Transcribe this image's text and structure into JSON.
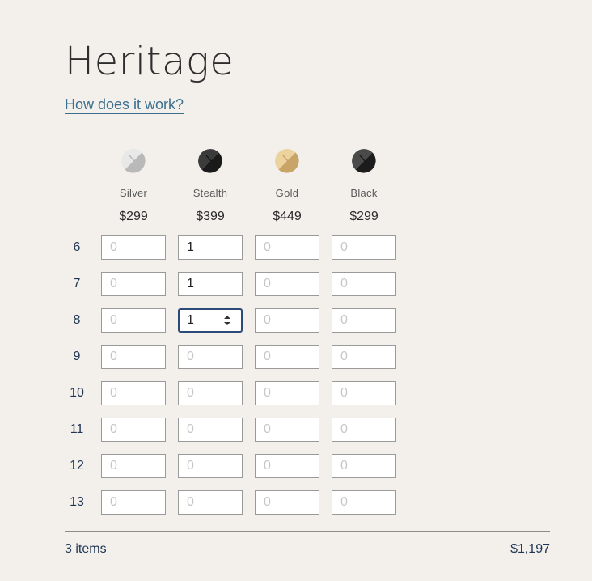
{
  "product": {
    "title": "Heritage",
    "help_link": "How does it work?"
  },
  "variants": [
    {
      "name": "Silver",
      "price": "$299",
      "swatch": "silver",
      "colors": [
        "#e8e8e8",
        "#b9b9b9"
      ]
    },
    {
      "name": "Stealth",
      "price": "$399",
      "swatch": "stealth",
      "colors": [
        "#3b3b3b",
        "#1a1a1a"
      ]
    },
    {
      "name": "Gold",
      "price": "$449",
      "swatch": "gold",
      "colors": [
        "#ecd29c",
        "#c9a467"
      ]
    },
    {
      "name": "Black",
      "price": "$299",
      "swatch": "black",
      "colors": [
        "#4a4a4a",
        "#1c1c1c"
      ]
    }
  ],
  "sizes": [
    "6",
    "7",
    "8",
    "9",
    "10",
    "11",
    "12",
    "13"
  ],
  "quantity_placeholder": "0",
  "quantities": [
    [
      "",
      "1",
      "",
      ""
    ],
    [
      "",
      "1",
      "",
      ""
    ],
    [
      "",
      "1",
      "",
      ""
    ],
    [
      "",
      "",
      "",
      ""
    ],
    [
      "",
      "",
      "",
      ""
    ],
    [
      "",
      "",
      "",
      ""
    ],
    [
      "",
      "",
      "",
      ""
    ],
    [
      "",
      "",
      "",
      ""
    ]
  ],
  "focused_field": {
    "size": "8",
    "variant": "Stealth"
  },
  "summary": {
    "item_count": "3 items",
    "total": "$1,197"
  },
  "colors": {
    "background": "#f3f0ec",
    "link": "#3d6f8e",
    "navy": "#1f3552",
    "focus_border": "#2c4a78"
  }
}
